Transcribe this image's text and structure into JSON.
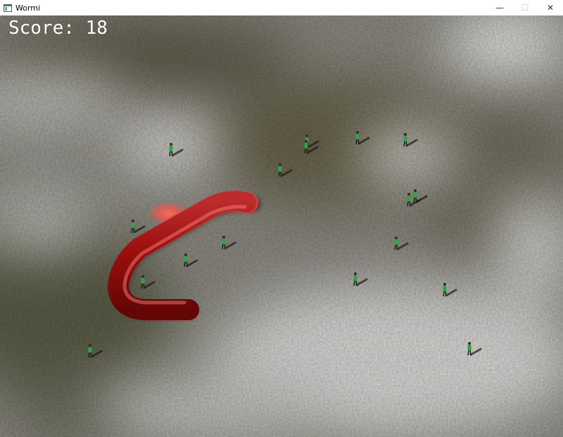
{
  "window": {
    "title": "Wormi",
    "icon": "app-window-icon",
    "controls": {
      "minimize": "—",
      "maximize": "☐",
      "close": "✕"
    }
  },
  "hud": {
    "score_label": "Score:",
    "score_value": "18",
    "score_text": "Score: 18"
  },
  "scene": {
    "ground_color": "#8e8c86",
    "worm_color": "#b01010",
    "person_shirt_color": "#2fa24a",
    "target_glow_color": "#ff5a50",
    "people_count": 17
  }
}
